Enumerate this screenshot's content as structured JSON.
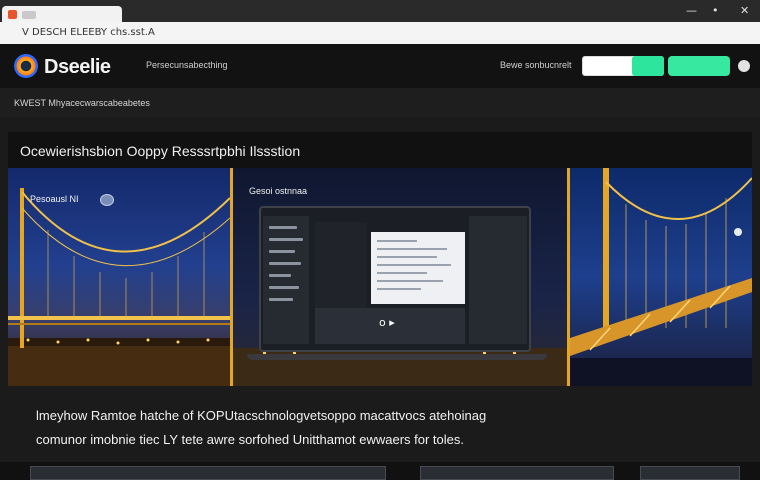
{
  "browser": {
    "url_text": "V DESCH ELEEBY chs.sst.A",
    "window_controls": [
      "—",
      "•",
      "✕"
    ]
  },
  "site": {
    "logo_text": "Dseelie",
    "nav_text": "Persecunsabecthing",
    "right_link": "Bewe sonbucnrelt"
  },
  "subbar": {
    "breadcrumb": "KWEST   Mhyacecwarscabeabetes"
  },
  "article": {
    "title": "Ocewierishsbion Ooppy Resssrtpbhi Ilssstion"
  },
  "hero": {
    "left_tag": "Pesoausl NI",
    "mid_label": "Gesoi ostnnaa",
    "play_glyph": "o ▸"
  },
  "description": {
    "line1": "lmeyhow Ramtoe hatche of KOPUtacschnologvetsoppo macattvocs atehoinag",
    "line2": "comunor imobnie tiec LY tete awre sorfohed Unitthamot ewwaers for toles."
  },
  "colors": {
    "accent_green": "#36e8a0",
    "bridge_gold": "#e5a721",
    "header_bg": "#121212"
  }
}
